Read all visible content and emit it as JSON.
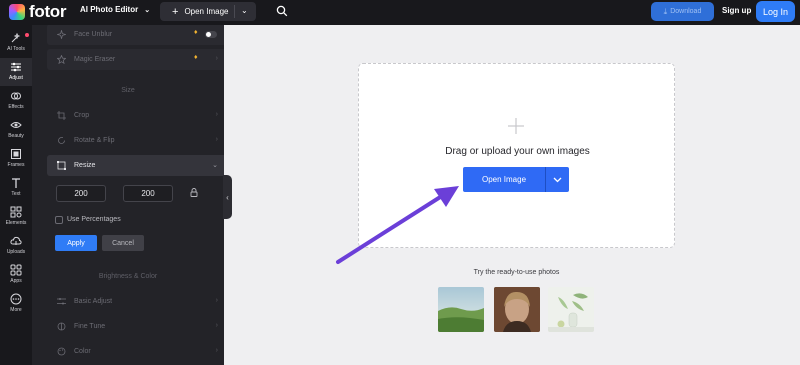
{
  "header": {
    "logo_text": "fotor",
    "app_menu_label": "AI Photo Editor",
    "open_image_label": "Open Image",
    "download_label": "Download",
    "signup_label": "Sign up",
    "login_label": "Log In"
  },
  "rail": {
    "items": [
      {
        "label": "AI Tools",
        "icon": "sparkle-icon",
        "badge": true
      },
      {
        "label": "Adjust",
        "icon": "sliders-icon",
        "active": true
      },
      {
        "label": "Effects",
        "icon": "effects-icon"
      },
      {
        "label": "Beauty",
        "icon": "eye-icon"
      },
      {
        "label": "Frames",
        "icon": "frame-icon"
      },
      {
        "label": "Text",
        "icon": "text-icon"
      },
      {
        "label": "Elements",
        "icon": "elements-icon"
      },
      {
        "label": "Uploads",
        "icon": "cloud-upload-icon"
      },
      {
        "label": "Apps",
        "icon": "apps-icon"
      },
      {
        "label": "More",
        "icon": "more-icon"
      }
    ]
  },
  "panel": {
    "face_unblur": "Face Unblur",
    "magic_eraser": "Magic Eraser",
    "section_size": "Size",
    "crop": "Crop",
    "rotate_flip": "Rotate & Flip",
    "resize": "Resize",
    "width_value": "200",
    "height_value": "200",
    "times_symbol": "×",
    "use_percentages": "Use Percentages",
    "apply": "Apply",
    "cancel": "Cancel",
    "section_brightness": "Brightness & Color",
    "basic_adjust": "Basic Adjust",
    "fine_tune": "Fine Tune",
    "color": "Color"
  },
  "canvas": {
    "drop_text": "Drag or upload your own images",
    "open_image_label": "Open Image",
    "ready_text": "Try the ready-to-use photos",
    "sample_photos": [
      "landscape",
      "portrait",
      "still-life"
    ]
  },
  "colors": {
    "accent": "#2f7cf6",
    "premium": "#f3b431",
    "arrow": "#6b3fd8"
  }
}
